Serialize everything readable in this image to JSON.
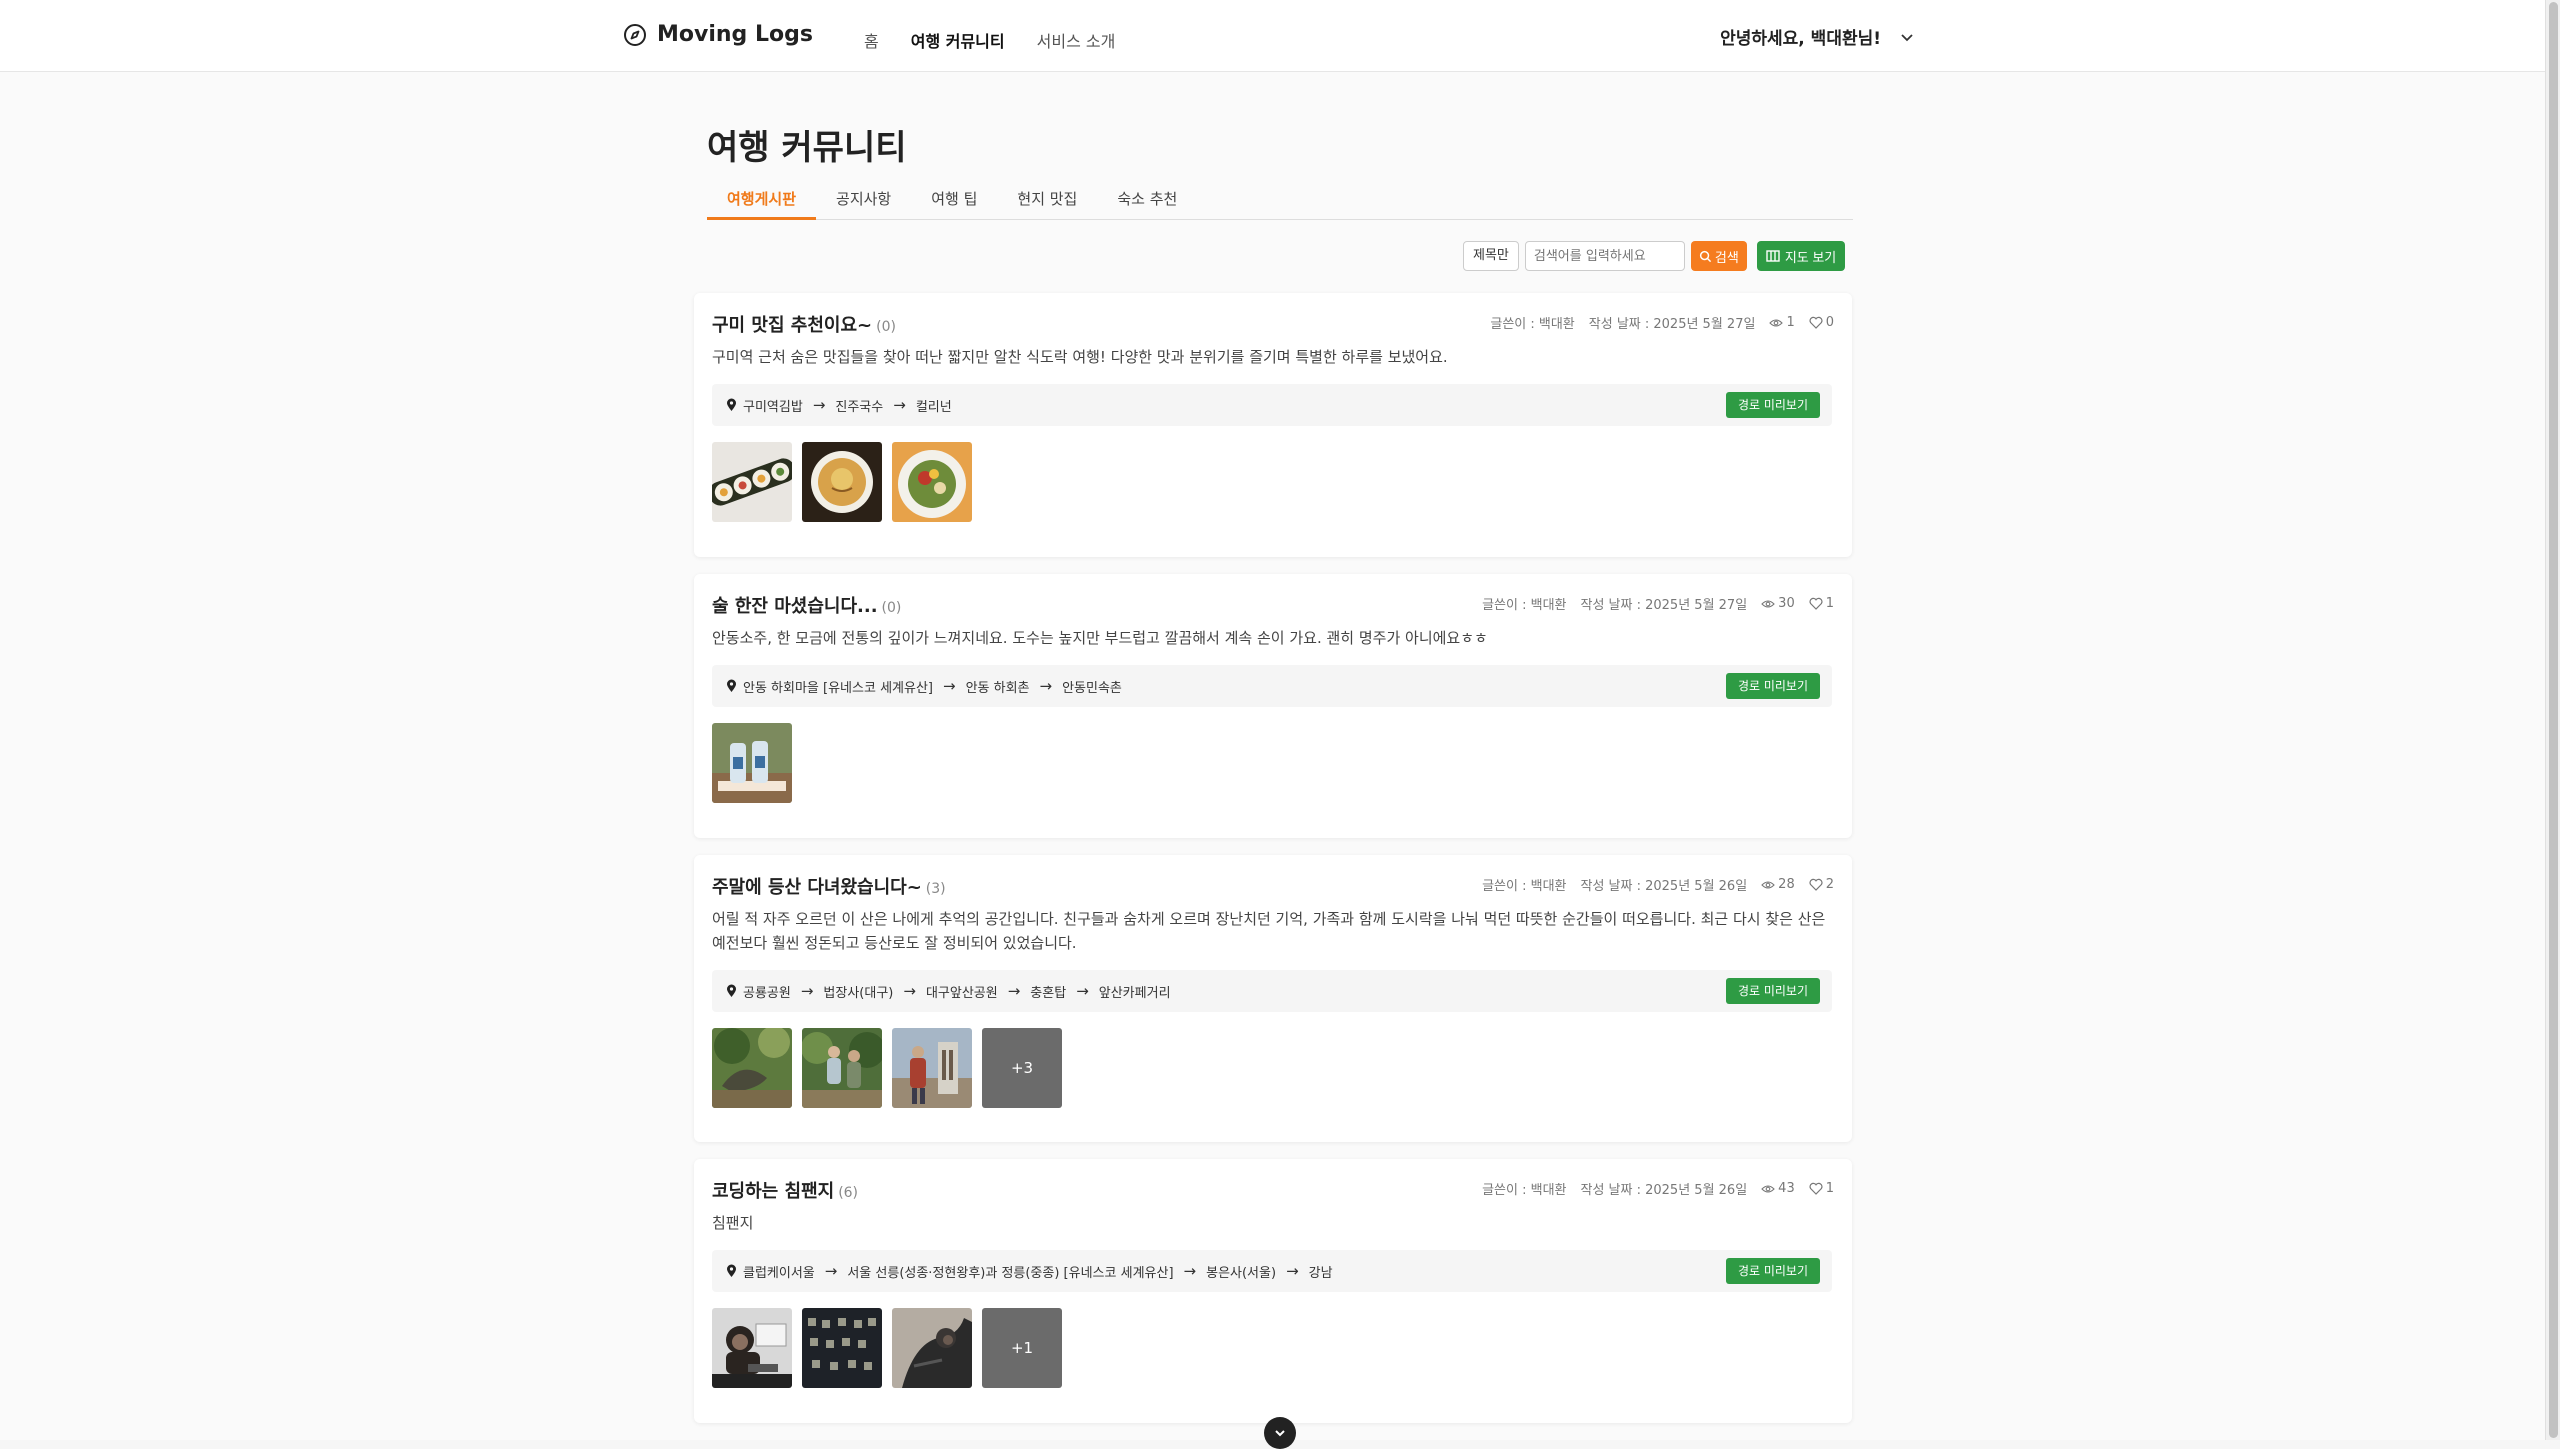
{
  "header": {
    "logo_text": "Moving Logs",
    "nav": [
      "홈",
      "여행 커뮤니티",
      "서비스 소개"
    ],
    "greeting": "안녕하세요, 백대환님!"
  },
  "page": {
    "title": "여행 커뮤니티",
    "tabs": [
      "여행게시판",
      "공지사항",
      "여행 팁",
      "현지 맛집",
      "숙소 추천"
    ]
  },
  "search": {
    "filter_label": "제목만",
    "placeholder": "검색어를 입력하세요",
    "search_label": "검색",
    "map_label": "지도 보기"
  },
  "route_preview_label": "경로 미리보기",
  "posts": [
    {
      "title": "구미 맛집 추천이요~",
      "comments": "(0)",
      "author": "글쓴이 : 백대환",
      "date": "작성 날짜 : 2025년 5월 27일",
      "views": "1",
      "likes": "0",
      "body": "구미역 근처 숨은 맛집들을 찾아 떠난 짧지만 알찬 식도락 여행! 다양한 맛과 분위기를 즐기며 특별한 하루를 보냈어요.",
      "route": [
        "구미역김밥",
        "진주국수",
        "컬리넌"
      ],
      "more": ""
    },
    {
      "title": "술 한잔 마셨습니다...",
      "comments": "(0)",
      "author": "글쓴이 : 백대환",
      "date": "작성 날짜 : 2025년 5월 27일",
      "views": "30",
      "likes": "1",
      "body": "안동소주, 한 모금에 전통의 깊이가 느껴지네요. 도수는 높지만 부드럽고 깔끔해서 계속 손이 가요. 괜히 명주가 아니에요ㅎㅎ",
      "route": [
        "안동 하회마을 [유네스코 세계유산]",
        "안동 하회촌",
        "안동민속촌"
      ],
      "more": ""
    },
    {
      "title": "주말에 등산 다녀왔습니다~",
      "comments": "(3)",
      "author": "글쓴이 : 백대환",
      "date": "작성 날짜 : 2025년 5월 26일",
      "views": "28",
      "likes": "2",
      "body": "어릴 적 자주 오르던 이 산은 나에게 추억의 공간입니다. 친구들과 숨차게 오르며 장난치던 기억, 가족과 함께 도시락을 나눠 먹던 따뜻한 순간들이 떠오릅니다. 최근 다시 찾은 산은 예전보다 훨씬 정돈되고 등산로도 잘 정비되어 있었습니다.",
      "route": [
        "공룡공원",
        "법장사(대구)",
        "대구앞산공원",
        "충혼탑",
        "앞산카페거리"
      ],
      "more": "+3"
    },
    {
      "title": "코딩하는 침팬지",
      "comments": "(6)",
      "author": "글쓴이 : 백대환",
      "date": "작성 날짜 : 2025년 5월 26일",
      "views": "43",
      "likes": "1",
      "body": "침팬지",
      "route": [
        "클럽케이서울",
        "서울 선릉(성종·정현왕후)과 정릉(중종) [유네스코 세계유산]",
        "봉은사(서울)",
        "강남"
      ],
      "more": "+1"
    }
  ]
}
